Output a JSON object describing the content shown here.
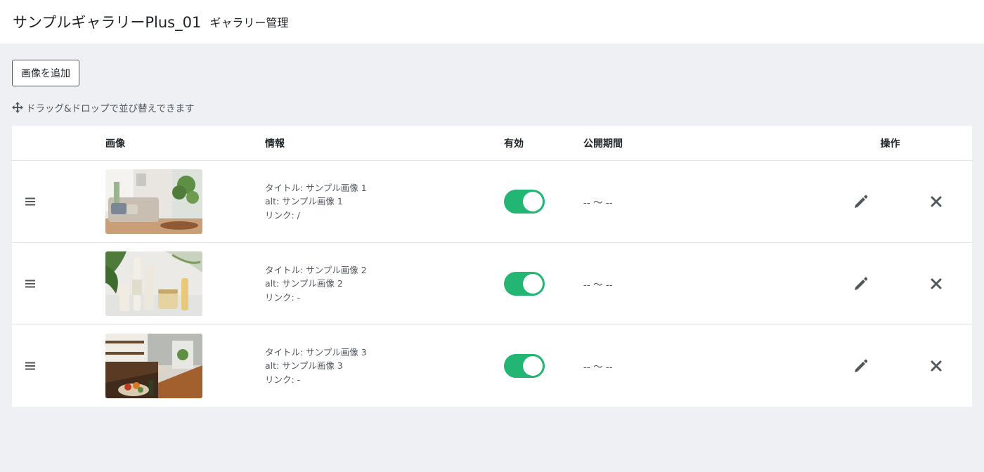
{
  "header": {
    "app_title": "サンプルギャラリーPlus_01",
    "page_title": "ギャラリー管理"
  },
  "toolbar": {
    "add_label": "画像を追加"
  },
  "hint": {
    "text": "ドラッグ&ドロップで並び替えできます"
  },
  "table": {
    "headers": {
      "image": "画像",
      "info": "情報",
      "active": "有効",
      "period": "公開期間",
      "ops": "操作"
    },
    "rows": [
      {
        "title": "タイトル: サンプル画像 1",
        "alt": "alt: サンプル画像 1",
        "link": "リンク: /",
        "active": true,
        "period": "-- 〜 --"
      },
      {
        "title": "タイトル: サンプル画像 2",
        "alt": "alt: サンプル画像 2",
        "link": "リンク: -",
        "active": true,
        "period": "-- 〜 --"
      },
      {
        "title": "タイトル: サンプル画像 3",
        "alt": "alt: サンプル画像 3",
        "link": "リンク: -",
        "active": true,
        "period": "-- 〜 --"
      }
    ]
  },
  "colors": {
    "toggle_on": "#22b573",
    "icon": "#50575e",
    "background": "#eff0f4"
  },
  "icons": {
    "hint": "move-icon",
    "drag": "drag-handle-icon",
    "edit": "pencil-icon",
    "delete": "close-icon"
  }
}
